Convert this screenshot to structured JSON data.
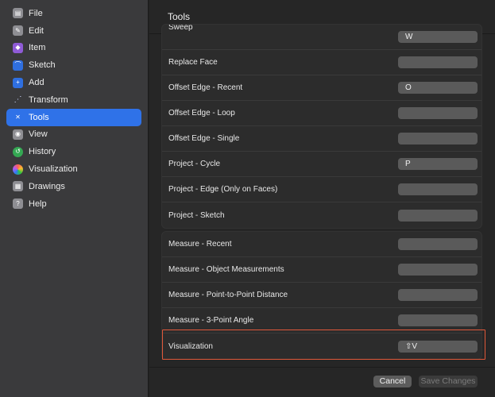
{
  "sidebar": {
    "items": [
      {
        "label": "File",
        "icon": "file-icon",
        "glyph": "▤",
        "color": "gray"
      },
      {
        "label": "Edit",
        "icon": "edit-icon",
        "glyph": "✎",
        "color": "gray"
      },
      {
        "label": "Item",
        "icon": "cube-icon",
        "glyph": "◆",
        "color": "purple"
      },
      {
        "label": "Sketch",
        "icon": "sketch-icon",
        "glyph": "⌒",
        "color": "blue"
      },
      {
        "label": "Add",
        "icon": "plus-icon",
        "glyph": "+",
        "color": "blue"
      },
      {
        "label": "Transform",
        "icon": "transform-icon",
        "glyph": "⋰",
        "color": "none"
      },
      {
        "label": "Tools",
        "icon": "tools-icon",
        "glyph": "✕",
        "color": "active"
      },
      {
        "label": "View",
        "icon": "eye-icon",
        "glyph": "◉",
        "color": "gray"
      },
      {
        "label": "History",
        "icon": "history-icon",
        "glyph": "↺",
        "color": "green"
      },
      {
        "label": "Visualization",
        "icon": "palette-icon",
        "glyph": "",
        "color": "rainbow"
      },
      {
        "label": "Drawings",
        "icon": "drawings-icon",
        "glyph": "▦",
        "color": "gray"
      },
      {
        "label": "Help",
        "icon": "help-icon",
        "glyph": "?",
        "color": "gray"
      }
    ]
  },
  "main": {
    "title": "Tools",
    "groups": [
      {
        "rows": [
          {
            "label": "Sweep",
            "shortcut": "W"
          },
          {
            "label": "Replace Face",
            "shortcut": ""
          },
          {
            "label": "Offset Edge - Recent",
            "shortcut": "O"
          },
          {
            "label": "Offset Edge - Loop",
            "shortcut": ""
          },
          {
            "label": "Offset Edge - Single",
            "shortcut": ""
          },
          {
            "label": "Project - Cycle",
            "shortcut": "P"
          },
          {
            "label": "Project - Edge (Only on Faces)",
            "shortcut": ""
          },
          {
            "label": "Project - Sketch",
            "shortcut": ""
          }
        ]
      },
      {
        "rows": [
          {
            "label": "Measure - Recent",
            "shortcut": ""
          },
          {
            "label": "Measure - Object Measurements",
            "shortcut": ""
          },
          {
            "label": "Measure - Point-to-Point Distance",
            "shortcut": ""
          },
          {
            "label": "Measure - 3-Point Angle",
            "shortcut": ""
          },
          {
            "label": "Visualization",
            "shortcut": "⇧V"
          }
        ]
      }
    ]
  },
  "footer": {
    "cancel_label": "Cancel",
    "save_label": "Save Changes"
  },
  "colors": {
    "accent": "#2f72e8",
    "highlight": "#e0583a"
  }
}
